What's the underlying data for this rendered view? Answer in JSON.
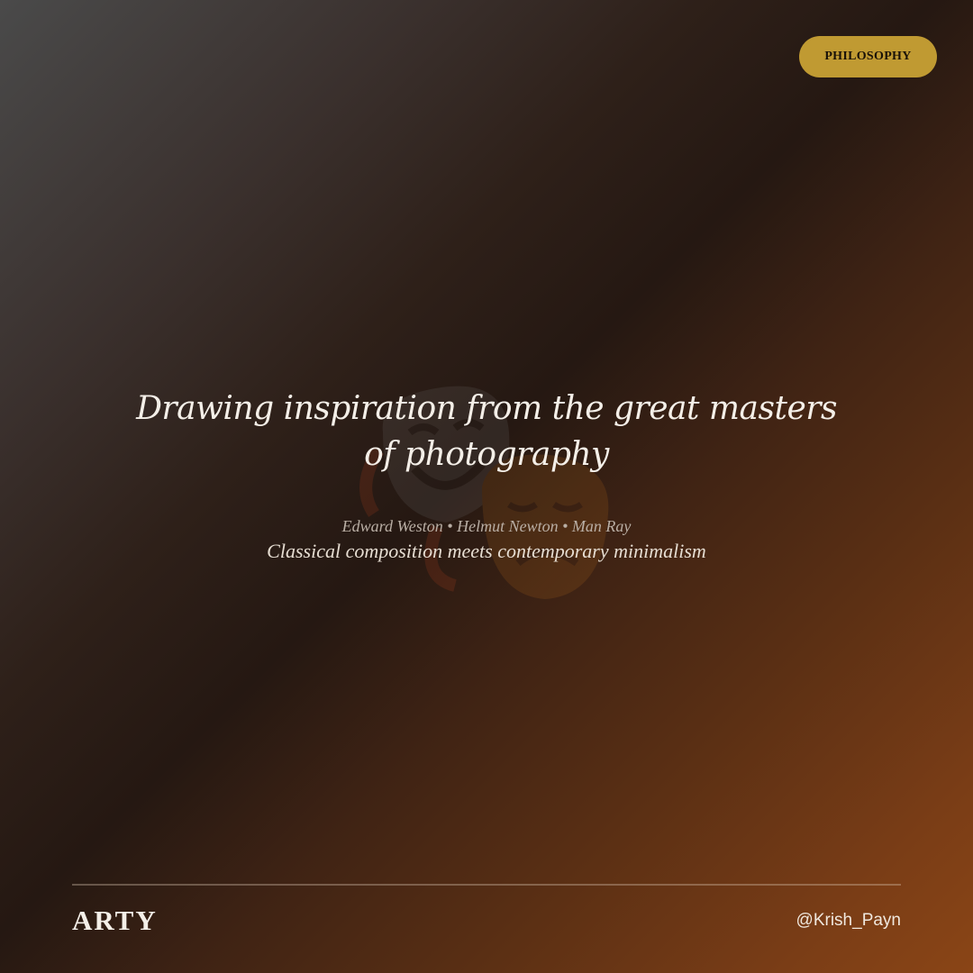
{
  "badge": {
    "label": "PHILOSOPHY"
  },
  "hero": {
    "headline": "Drawing inspiration from the great masters of photography",
    "names": "Edward Weston • Helmut Newton • Man Ray",
    "tagline": "Classical composition meets contemporary minimalism",
    "watermark_icon": "theater-masks-icon"
  },
  "footer": {
    "brand": "ARTY",
    "handle": "@Krish_Payn"
  },
  "colors": {
    "accent": "#c09a32",
    "gradient_start": "#4a4a4a",
    "gradient_mid": "#251812",
    "gradient_end": "#8a4516"
  }
}
